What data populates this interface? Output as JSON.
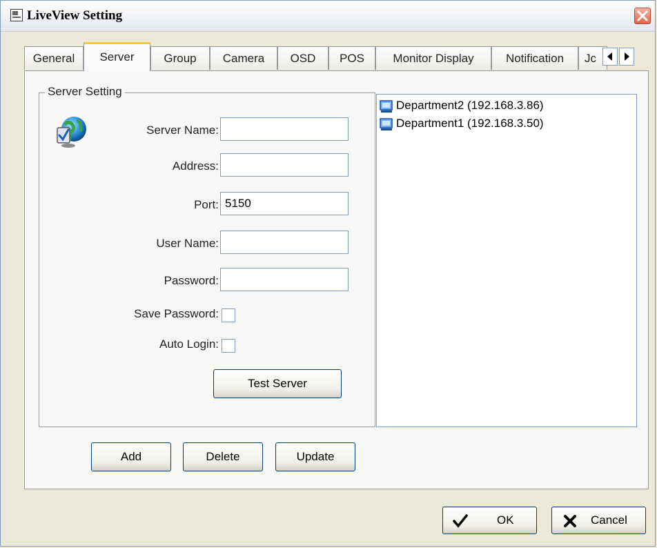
{
  "window": {
    "title": "LiveView Setting"
  },
  "tabs": [
    {
      "label": "General"
    },
    {
      "label": "Server"
    },
    {
      "label": "Group"
    },
    {
      "label": "Camera"
    },
    {
      "label": "OSD"
    },
    {
      "label": "POS"
    },
    {
      "label": "Monitor Display"
    },
    {
      "label": "Notification"
    },
    {
      "label": "Jc"
    }
  ],
  "active_tab": "Server",
  "server_setting": {
    "legend": "Server Setting",
    "server_name_label": "Server Name:",
    "server_name_value": "",
    "address_label": "Address:",
    "address_value": "",
    "port_label": "Port:",
    "port_value": "5150",
    "user_name_label": "User Name:",
    "user_name_value": "",
    "password_label": "Password:",
    "password_value": "",
    "save_password_label": "Save Password:",
    "save_password_checked": false,
    "auto_login_label": "Auto Login:",
    "auto_login_checked": false,
    "test_server_label": "Test Server"
  },
  "server_list": [
    {
      "label": "Department2 (192.168.3.86)"
    },
    {
      "label": "Department1 (192.168.3.50)"
    }
  ],
  "actions": {
    "add_label": "Add",
    "delete_label": "Delete",
    "update_label": "Update"
  },
  "footer": {
    "ok_label": "OK",
    "cancel_label": "Cancel"
  },
  "icons": {
    "title": "settings-window-icon",
    "close": "close-icon",
    "server": "globe-check-icon",
    "list_item": "computer-icon",
    "ok": "checkmark-icon",
    "cancel": "x-icon",
    "tab_left": "arrow-left-icon",
    "tab_right": "arrow-right-icon"
  },
  "colors": {
    "accent_tab": "#ffc83c",
    "close_button": "#e0654d",
    "window_bg": "#ece9d8",
    "panel_bg": "#f8f8f6"
  }
}
